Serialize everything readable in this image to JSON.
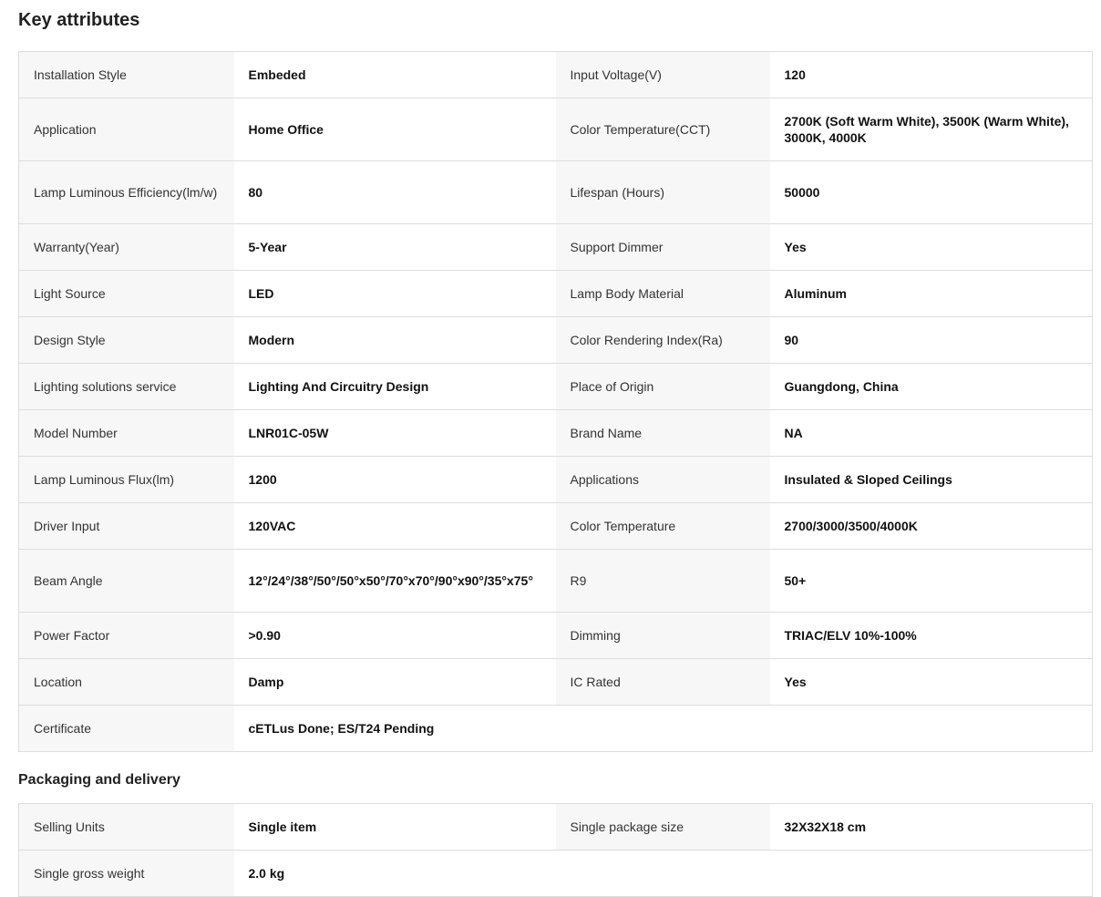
{
  "key_attributes": {
    "title": "Key attributes",
    "rows": [
      {
        "l1": "Installation Style",
        "v1": "Embeded",
        "l2": "Input Voltage(V)",
        "v2": "120"
      },
      {
        "l1": "Application",
        "v1": "Home Office",
        "l2": "Color Temperature(CCT)",
        "v2": "2700K (Soft Warm White), 3500K (Warm White), 3000K, 4000K"
      },
      {
        "l1": "Lamp Luminous Efficiency(lm/w)",
        "v1": "80",
        "l2": "Lifespan (Hours)",
        "v2": "50000"
      },
      {
        "l1": "Warranty(Year)",
        "v1": "5-Year",
        "l2": "Support Dimmer",
        "v2": "Yes"
      },
      {
        "l1": "Light Source",
        "v1": "LED",
        "l2": "Lamp Body Material",
        "v2": "Aluminum"
      },
      {
        "l1": "Design Style",
        "v1": "Modern",
        "l2": "Color Rendering Index(Ra)",
        "v2": "90"
      },
      {
        "l1": "Lighting solutions service",
        "v1": "Lighting And Circuitry Design",
        "l2": "Place of Origin",
        "v2": "Guangdong, China"
      },
      {
        "l1": "Model Number",
        "v1": "LNR01C-05W",
        "l2": "Brand Name",
        "v2": "NA"
      },
      {
        "l1": "Lamp Luminous Flux(lm)",
        "v1": "1200",
        "l2": "Applications",
        "v2": "Insulated & Sloped Ceilings"
      },
      {
        "l1": "Driver Input",
        "v1": "120VAC",
        "l2": "Color Temperature",
        "v2": "2700/3000/3500/4000K"
      },
      {
        "l1": "Beam Angle",
        "v1": "12°/24°/38°/50°/50°x50°/70°x70°/90°x90°/35°x75°",
        "l2": "R9",
        "v2": "50+"
      },
      {
        "l1": "Power Factor",
        "v1": ">0.90",
        "l2": "Dimming",
        "v2": "TRIAC/ELV 10%-100%"
      },
      {
        "l1": "Location",
        "v1": "Damp",
        "l2": "IC Rated",
        "v2": "Yes"
      },
      {
        "l1": "Certificate",
        "v1": "cETLus Done; ES/T24 Pending"
      }
    ]
  },
  "packaging": {
    "title": "Packaging and delivery",
    "rows": [
      {
        "l1": "Selling Units",
        "v1": "Single item",
        "l2": "Single package size",
        "v2": "32X32X18 cm"
      },
      {
        "l1": "Single gross weight",
        "v1": "2.0 kg"
      }
    ]
  }
}
